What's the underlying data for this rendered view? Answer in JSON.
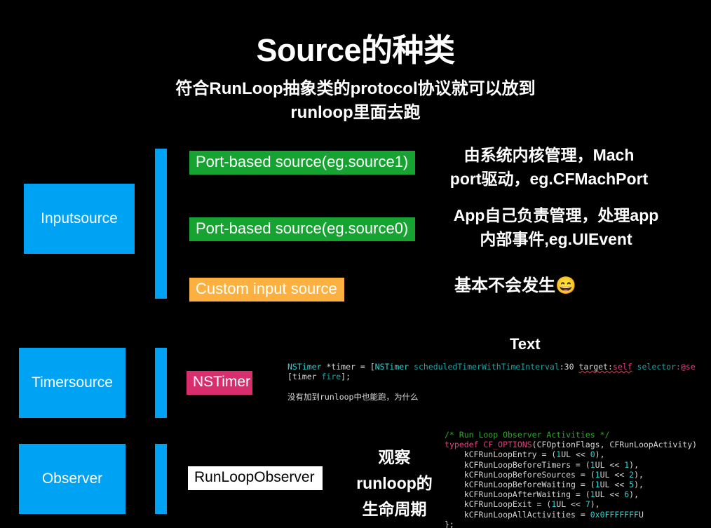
{
  "slide": {
    "background_color": "#000000",
    "title": "Source的种类",
    "subtitle_line1": "符合RunLoop抽象类的protocol协议就可以放到",
    "subtitle_line2": "runloop里面去跑"
  },
  "colors": {
    "blue": "#00a2f3",
    "green": "#16a331",
    "orange": "#fbb040",
    "pink": "#d82e6e",
    "white": "#ffffff",
    "code_teal": "#2ad4d4",
    "code_magenta": "#e0407f",
    "code_green": "#2fa82f"
  },
  "rows": [
    {
      "category": "Inputsource",
      "chips": [
        {
          "label": "Port-based source(eg.source1)",
          "color": "green"
        },
        {
          "label": "Port-based source(eg.source0)",
          "color": "green"
        },
        {
          "label": "Custom input source",
          "color": "orange"
        }
      ],
      "descriptions": [
        "由系统内核管理，Mach\nport驱动，eg.CFMachPort",
        "App自己负责管理，处理app\n内部事件,eg.UIEvent",
        "基本不会发生😄"
      ]
    },
    {
      "category": "Timersource",
      "chips": [
        {
          "label": "NSTimer",
          "color": "pink"
        }
      ],
      "section_label": "Text",
      "code_note": "没有加到runloop中也能跑，为什么",
      "code": {
        "line1": "NSTimer *timer = [NSTimer scheduledTimerWithTimeInterval:30 target:self selector:@se",
        "line2": "[timer fire];"
      }
    },
    {
      "category": "Observer",
      "chips": [
        {
          "label": "RunLoopObserver",
          "color": "white"
        }
      ],
      "description": "观察\nrunloop的\n生命周期",
      "code_lines": [
        "/* Run Loop Observer Activities */",
        "typedef CF_OPTIONS(CFOptionFlags, CFRunLoopActivity)",
        "    kCFRunLoopEntry = (1UL << 0),",
        "    kCFRunLoopBeforeTimers = (1UL << 1),",
        "    kCFRunLoopBeforeSources = (1UL << 2),",
        "    kCFRunLoopBeforeWaiting = (1UL << 5),",
        "    kCFRunLoopAfterWaiting = (1UL << 6),",
        "    kCFRunLoopExit = (1UL << 7),",
        "    kCFRunLoopAllActivities = 0x0FFFFFFFU",
        "};"
      ]
    }
  ],
  "code_tokens": {
    "timer": {
      "t_nstimer": "NSTimer",
      "t_star_timer": " *timer = [",
      "t_nstimer2": "NSTimer",
      "t_sched": " scheduledTimerWithTimeInterval",
      "t_colon30": ":30 ",
      "t_target": "target:",
      "t_self": "self",
      "t_selector": " selector",
      "t_selcolon": ":@se",
      "t_line2a": "[timer ",
      "t_fire": "fire",
      "t_line2b": "];"
    },
    "observer": {
      "comment": "/* Run Loop Observer Activities */",
      "typedef_kw": "typedef ",
      "cf_options": "CF_OPTIONS",
      "cf_args": "(CFOptionFlags, CFRunLoopActivity)",
      "entry_name": "    kCFRunLoopEntry = (",
      "one": "1",
      "ul_shift": "UL << ",
      "z0": "0",
      "z1": "1",
      "z2": "2",
      "z5": "5",
      "z6": "6",
      "z7": "7",
      "close": "),",
      "before_timers": "    kCFRunLoopBeforeTimers = (",
      "before_sources": "    kCFRunLoopBeforeSources = (",
      "before_waiting": "    kCFRunLoopBeforeWaiting = (",
      "after_waiting": "    kCFRunLoopAfterWaiting = (",
      "exit": "    kCFRunLoopExit = (",
      "all_activities": "    kCFRunLoopAllActivities = ",
      "hex": "0x0FFFFFFF",
      "u": "U",
      "end": "};"
    }
  }
}
